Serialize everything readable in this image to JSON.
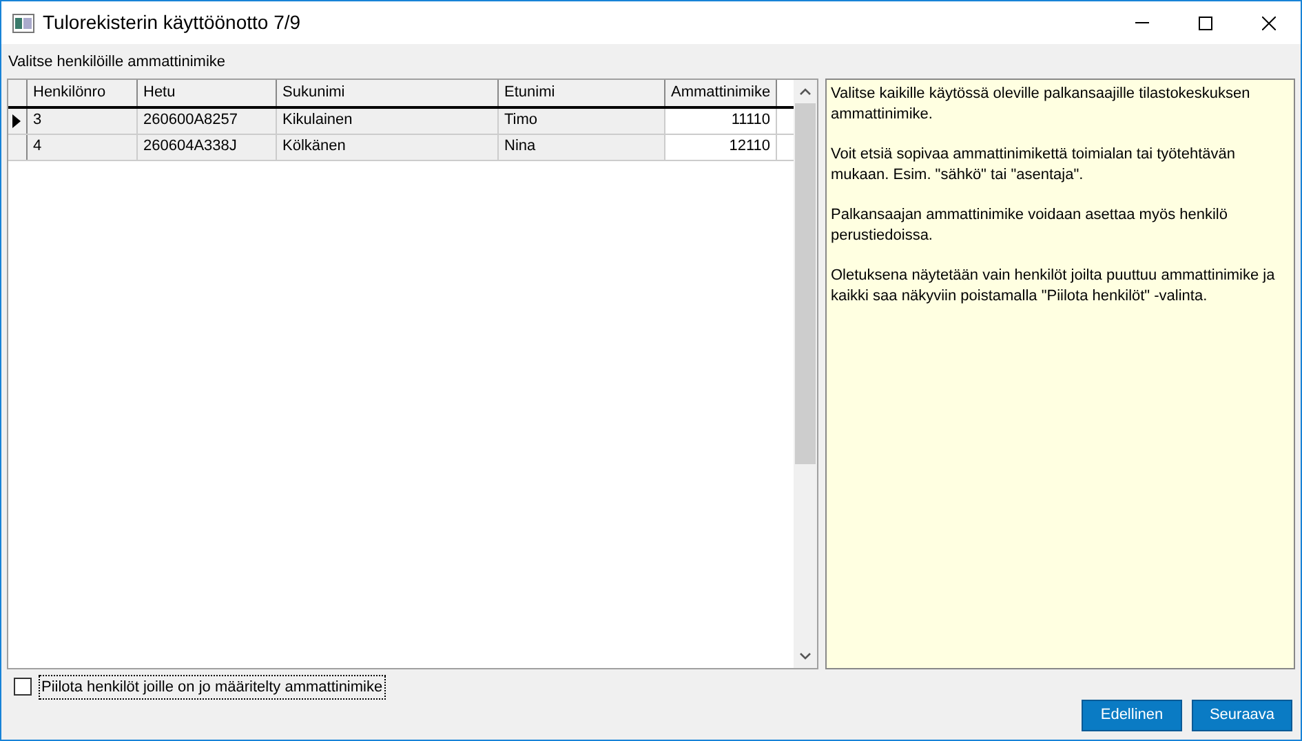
{
  "window": {
    "title": "Tulorekisterin käyttöönotto 7/9"
  },
  "section_label": "Valitse henkilöille ammattinimike",
  "table": {
    "columns": [
      "Henkilönro",
      "Hetu",
      "Sukunimi",
      "Etunimi",
      "Ammattinimike"
    ],
    "rows": [
      {
        "selected": true,
        "cells": [
          "3",
          "260600A8257",
          "Kikulainen",
          "Timo",
          "11110"
        ]
      },
      {
        "selected": false,
        "cells": [
          "4",
          "260604A338J",
          "Kölkänen",
          "Nina",
          "12110"
        ]
      }
    ]
  },
  "help_paragraphs": [
    "Valitse kaikille käytössä oleville palkansaajille tilastokeskuksen ammattinimike.",
    "Voit etsiä sopivaa ammattinimikettä toimialan tai työtehtävän mukaan. Esim. \"sähkö\" tai \"asentaja\".",
    "Palkansaajan ammattinimike voidaan asettaa myös henkilö perustiedoissa.",
    "Oletuksena näytetään vain henkilöt joilta puuttuu ammattinimike ja kaikki saa näkyviin poistamalla \"Piilota henkilöt\" -valinta."
  ],
  "hide_checkbox": {
    "label": "Piilota henkilöt joille on jo määritelty ammattinimike",
    "checked": false
  },
  "buttons": [
    "Edellinen",
    "Seuraava"
  ]
}
